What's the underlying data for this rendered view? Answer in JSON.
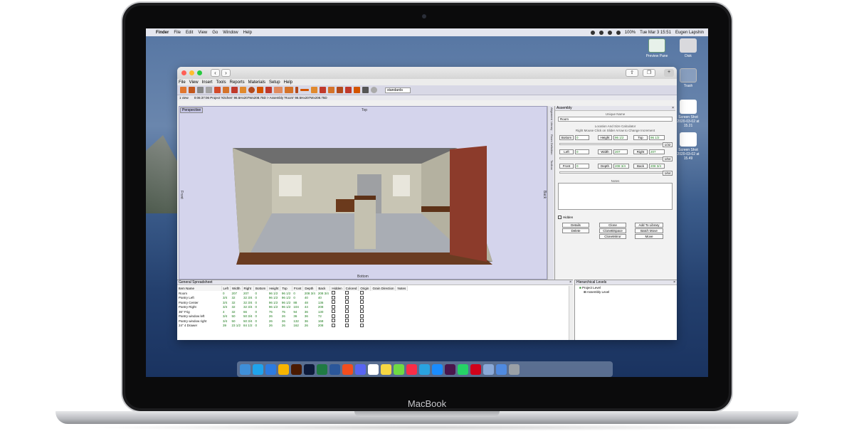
{
  "laptop": {
    "brand": "MacBook"
  },
  "menubar": {
    "app": "Finder",
    "items": [
      "File",
      "Edit",
      "View",
      "Go",
      "Window",
      "Help"
    ],
    "battery": "100%",
    "datetime": "Tue Mar 3 15:51",
    "user": "Eugen Lapshin"
  },
  "desktop": {
    "icons": [
      "Preview Pane",
      "Disk",
      "Trash",
      "Screen Shot 2020-03-02 at 15.21",
      "Screen Shot 2020-03-02 at 15.49"
    ]
  },
  "app": {
    "menus": [
      "File",
      "View",
      "Insert",
      "Tools",
      "Reports",
      "Materials",
      "Setup",
      "Help"
    ],
    "style_select": "standards",
    "view_select": "1 view",
    "path": "0:06:37:06  Project 'Kitchen'  96.5Hx207Wx208.75D > Assembly 'Room' 96.5Hx207Wx208.75D",
    "viewport": {
      "tab": "Perspective",
      "top": "Top",
      "bottom": "Bottom",
      "front": "Front",
      "back": "Back"
    },
    "side_tabs": [
      "Alignment",
      "Library",
      "Room Definition",
      "Toolbox"
    ],
    "assembly": {
      "title": "Assembly",
      "unique_name_label": "Unique Name",
      "unique_name": "Room",
      "calc_label": "Location And Size Calculator",
      "hint": "Right Mouse Click on Slider Arrow to Change Increment",
      "bottom": "Bottom",
      "bottom_val": "0",
      "height": "Height",
      "height_val": "96 1/2",
      "top": "Top",
      "top_val": "96 1/2",
      "left": "Left",
      "left_val": "0",
      "width": "Width",
      "width_val": "207",
      "right": "Right",
      "right_val": "207",
      "front": "Front",
      "front_val": "0",
      "depth": "Depth",
      "depth_val": "208 3/4",
      "back": "Back",
      "back_val": "208 3/4",
      "inc1": "1/32",
      "inc2": "1/64",
      "inc3": "1/64",
      "notes": "Notes",
      "hidden": "Hidden",
      "buttons": [
        "Details",
        "Clone",
        "Add To Library",
        "Delete",
        "CloneBSpace",
        "Batch Move",
        "CloneMirror",
        "Move"
      ]
    },
    "sheet": {
      "title": "General Spreadsheet",
      "columns": [
        "Item Name",
        "Left",
        "Width",
        "Right",
        "Bottom",
        "Height",
        "Top",
        "Front",
        "Depth",
        "Back",
        "Hidden",
        "Colored",
        "Origin",
        "Grain Direction",
        "Notes"
      ],
      "rows": [
        [
          "Room",
          "0",
          "207",
          "207",
          "0",
          "96 1/2",
          "96 1/2",
          "0",
          "208 3/4",
          "208 3/4"
        ],
        [
          "Pantry Left",
          "3/4",
          "32",
          "32 3/4",
          "0",
          "96 1/2",
          "96 1/2",
          "0",
          "40",
          "40"
        ],
        [
          "Pantry Center",
          "3/4",
          "32",
          "32 3/4",
          "0",
          "96 1/2",
          "96 1/2",
          "88",
          "48",
          "136"
        ],
        [
          "Pantry Right",
          "3/4",
          "32",
          "32 3/4",
          "0",
          "96 1/2",
          "96 1/2",
          "104",
          "44",
          "208"
        ],
        [
          "36\" Frig",
          "4",
          "32",
          "66",
          "0",
          "75",
          "75",
          "94",
          "36",
          "130"
        ],
        [
          "Pantry window left",
          "3/4",
          "50",
          "50 3/4",
          "0",
          "26",
          "26",
          "36",
          "36",
          "72"
        ],
        [
          "Pantry window right",
          "3/4",
          "50",
          "50 3/4",
          "0",
          "26",
          "26",
          "132",
          "36",
          "168"
        ],
        [
          "24\" 4 Drawer",
          "39",
          "23 1/2",
          "84 1/2",
          "0",
          "26",
          "26",
          "162",
          "26",
          "208"
        ]
      ]
    },
    "hier": {
      "title": "Hierarchical Levels",
      "items": [
        "Project Level",
        "Assembly Level"
      ]
    }
  },
  "dock": {
    "apps": [
      "Finder",
      "Skype",
      "Safari",
      "Sketch",
      "Illustrator",
      "Photoshop",
      "Excel",
      "Word",
      "Figma",
      "Discord",
      "Calendar",
      "Notes",
      "Upwork",
      "Music",
      "Telegram",
      "App Store",
      "Slack",
      "WhatsApp",
      "Opera",
      "Preview",
      "Downloads",
      "Trash"
    ]
  }
}
